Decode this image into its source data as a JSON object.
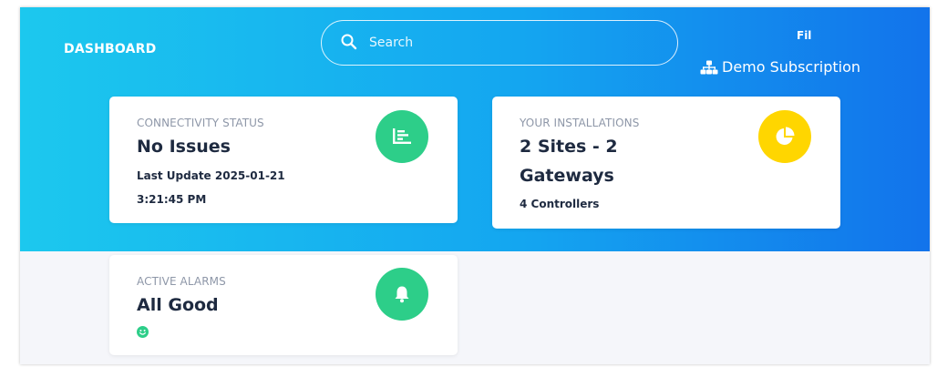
{
  "header": {
    "title": "DASHBOARD",
    "user_name": "Fil",
    "subscription": "Demo Subscription"
  },
  "search": {
    "placeholder": "Search"
  },
  "cards": {
    "connectivity": {
      "label": "CONNECTIVITY STATUS",
      "value": "No Issues",
      "sub_line1": "Last Update 2025-01-21",
      "sub_line2": "3:21:45 PM",
      "icon": "bar-chart-icon",
      "icon_color": "#2dce89"
    },
    "installations": {
      "label": "YOUR INSTALLATIONS",
      "value_line1": "2 Sites - 2",
      "value_line2": "Gateways",
      "sub": "4 Controllers",
      "icon": "pie-chart-icon",
      "icon_color": "#ffd600"
    },
    "alarms": {
      "label": "ACTIVE ALARMS",
      "value": "All Good",
      "status_icon": "smile-icon",
      "status_color": "#2dce89",
      "icon": "bell-icon",
      "icon_color": "#2dce89"
    }
  },
  "colors": {
    "header_gradient_start": "#1cc8ee",
    "header_gradient_end": "#1273eb",
    "text_dark": "#1e2a40",
    "text_muted": "#8e97a8"
  }
}
